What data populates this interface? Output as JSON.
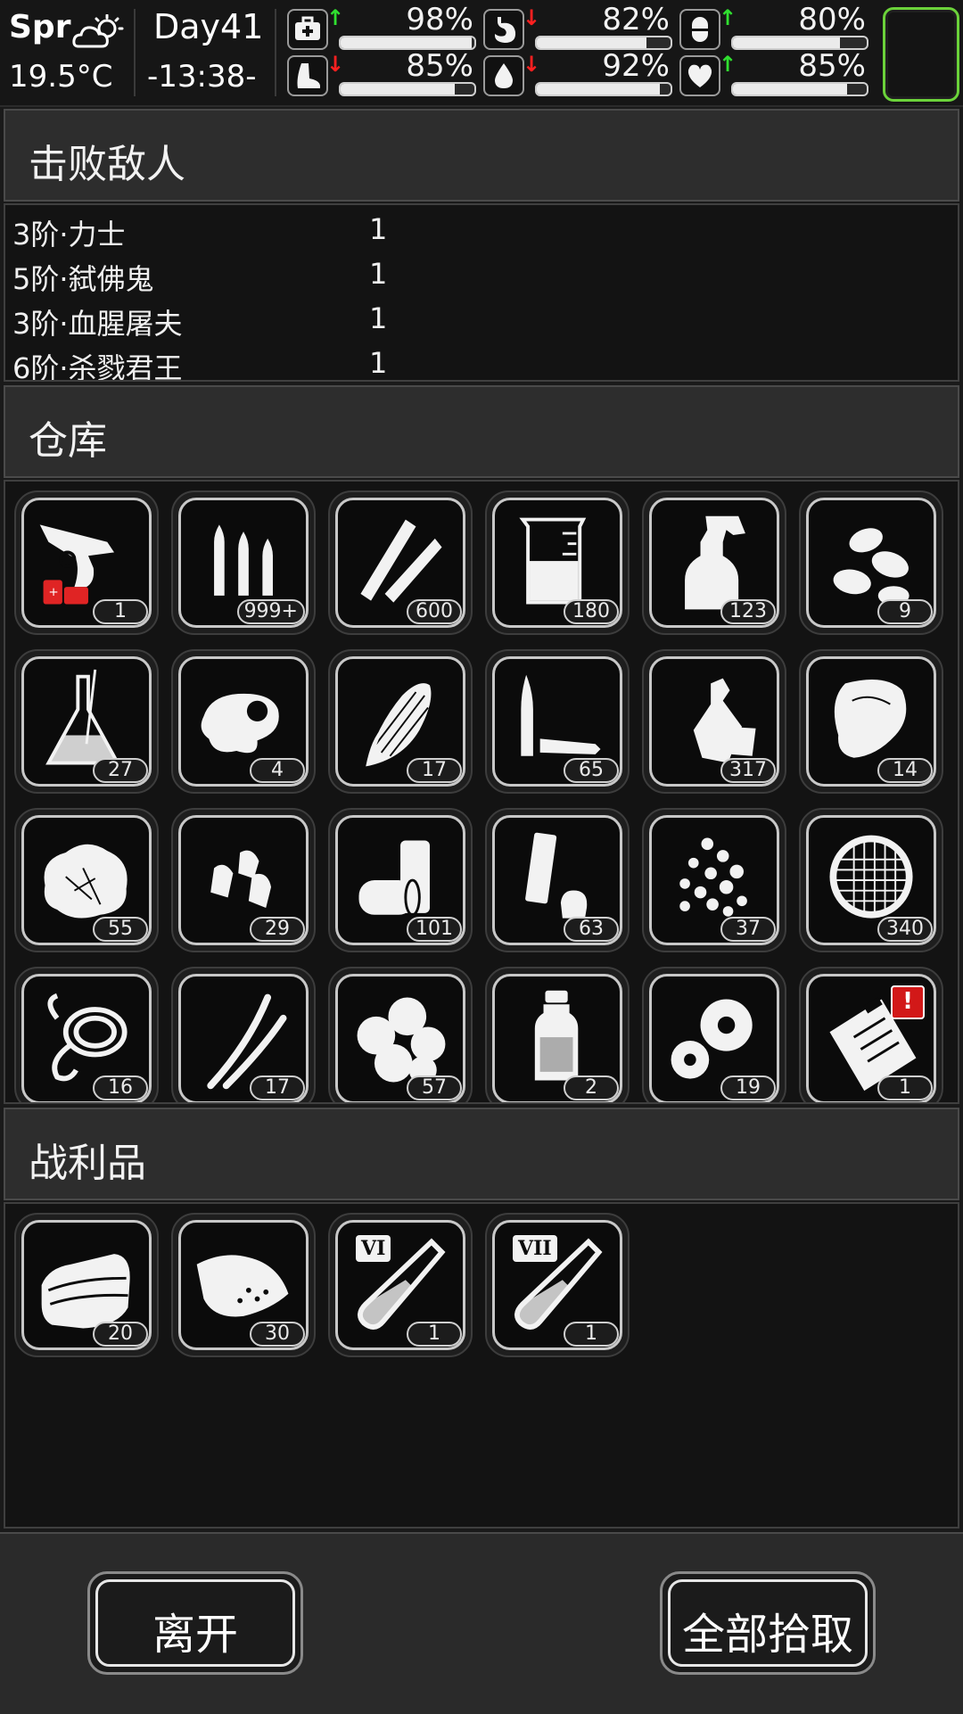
{
  "status": {
    "season": "Spr",
    "temperature": "19.5°C",
    "day": "Day41",
    "time": "-13:38-",
    "stats": [
      {
        "name": "health",
        "icon": "first-aid-icon",
        "trend": "up",
        "value": "98%",
        "level": 0.98
      },
      {
        "name": "hunger",
        "icon": "stomach-icon",
        "trend": "down",
        "value": "82%",
        "level": 0.82
      },
      {
        "name": "immunity",
        "icon": "pill-icon",
        "trend": "up",
        "value": "80%",
        "level": 0.8
      },
      {
        "name": "stamina",
        "icon": "foot-icon",
        "trend": "down",
        "value": "85%",
        "level": 0.85
      },
      {
        "name": "thirst",
        "icon": "water-drop-icon",
        "trend": "down",
        "value": "92%",
        "level": 0.92
      },
      {
        "name": "mood",
        "icon": "heart-icon",
        "trend": "up",
        "value": "85%",
        "level": 0.85
      }
    ],
    "arrows": {
      "up": "↑",
      "down": "↓"
    }
  },
  "sections": {
    "defeated": "击败敌人",
    "warehouse": "仓库",
    "loot": "战利品"
  },
  "enemies": [
    {
      "name": "3阶·力士",
      "count": "1"
    },
    {
      "name": "5阶·弑佛鬼",
      "count": "1"
    },
    {
      "name": "3阶·血腥屠夫",
      "count": "1"
    },
    {
      "name": "6阶·杀戮君王",
      "count": "1"
    }
  ],
  "warehouse": [
    {
      "icon": "flare-gun-icon",
      "count": "1"
    },
    {
      "icon": "rifle-ammo-icon",
      "count": "999+"
    },
    {
      "icon": "bullets-icon",
      "count": "600"
    },
    {
      "icon": "beaker-icon",
      "count": "180"
    },
    {
      "icon": "spray-bottle-icon",
      "count": "123"
    },
    {
      "icon": "seeds-icon",
      "count": "9"
    },
    {
      "icon": "flask-icon",
      "count": "27"
    },
    {
      "icon": "raw-meat-icon",
      "count": "4"
    },
    {
      "icon": "corn-icon",
      "count": "17"
    },
    {
      "icon": "shells-icon",
      "count": "65"
    },
    {
      "icon": "plastic-bottle-icon",
      "count": "317"
    },
    {
      "icon": "steak-icon",
      "count": "14"
    },
    {
      "icon": "fiber-icon",
      "count": "55"
    },
    {
      "icon": "bullet-heads-icon",
      "count": "29"
    },
    {
      "icon": "tin-cans-icon",
      "count": "101"
    },
    {
      "icon": "shotgun-shell-icon",
      "count": "63"
    },
    {
      "icon": "pellets-icon",
      "count": "37"
    },
    {
      "icon": "sieve-icon",
      "count": "340"
    },
    {
      "icon": "rope-icon",
      "count": "16"
    },
    {
      "icon": "wire-icon",
      "count": "17"
    },
    {
      "icon": "cotton-icon",
      "count": "57"
    },
    {
      "icon": "medicine-bottle-icon",
      "count": "2"
    },
    {
      "icon": "gears-icon",
      "count": "19"
    },
    {
      "icon": "clipboard-icon",
      "count": "1",
      "alert": "!"
    }
  ],
  "loot": [
    {
      "icon": "cloth-icon",
      "count": "20"
    },
    {
      "icon": "leather-icon",
      "count": "30"
    },
    {
      "icon": "test-tube-icon",
      "count": "1",
      "tag": "VI"
    },
    {
      "icon": "test-tube-icon",
      "count": "1",
      "tag": "VII"
    }
  ],
  "buttons": {
    "leave": "离开",
    "pick_all": "全部拾取"
  }
}
